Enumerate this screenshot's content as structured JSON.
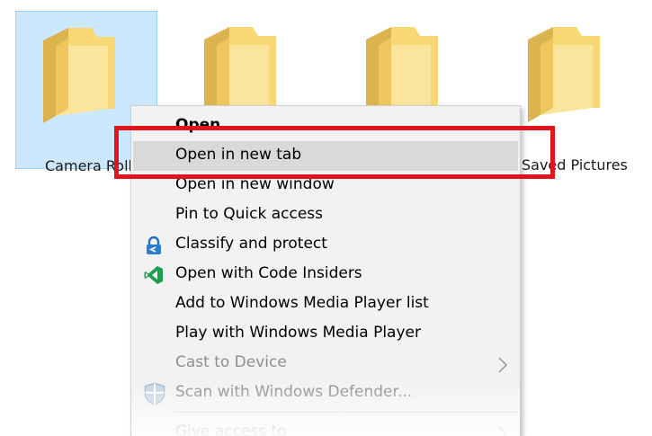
{
  "folders": [
    {
      "label": "Camera Roll",
      "selected": true
    },
    {
      "label": "",
      "selected": false
    },
    {
      "label": "",
      "selected": false
    },
    {
      "label": "Saved Pictures",
      "selected": false
    }
  ],
  "context_menu": {
    "items": [
      {
        "label": "Open",
        "icon": null,
        "style": "bold"
      },
      {
        "label": "Open in new tab",
        "icon": null,
        "style": "highlighted"
      },
      {
        "label": "Open in new window",
        "icon": null
      },
      {
        "label": "Pin to Quick access",
        "icon": null
      },
      {
        "label": "Classify and protect",
        "icon": "lock-icon"
      },
      {
        "label": "Open with Code Insiders",
        "icon": "vscode-insiders-icon"
      },
      {
        "label": "Add to Windows Media Player list",
        "icon": null
      },
      {
        "label": "Play with Windows Media Player",
        "icon": null
      },
      {
        "label": "Cast to Device",
        "icon": null,
        "disabled": true,
        "submenu": true
      },
      {
        "label": "Scan with Windows Defender...",
        "icon": "windows-defender-icon",
        "disabled": true
      },
      {
        "label": "Give access to",
        "icon": null,
        "disabled": true,
        "submenu": true
      }
    ]
  },
  "colors": {
    "selection_fill": "#cce8ff",
    "menu_background": "#f2f2f2",
    "menu_highlight": "#d9d9d9",
    "annotation_red": "#e0141a",
    "folder_yellow": "#f8d775"
  }
}
